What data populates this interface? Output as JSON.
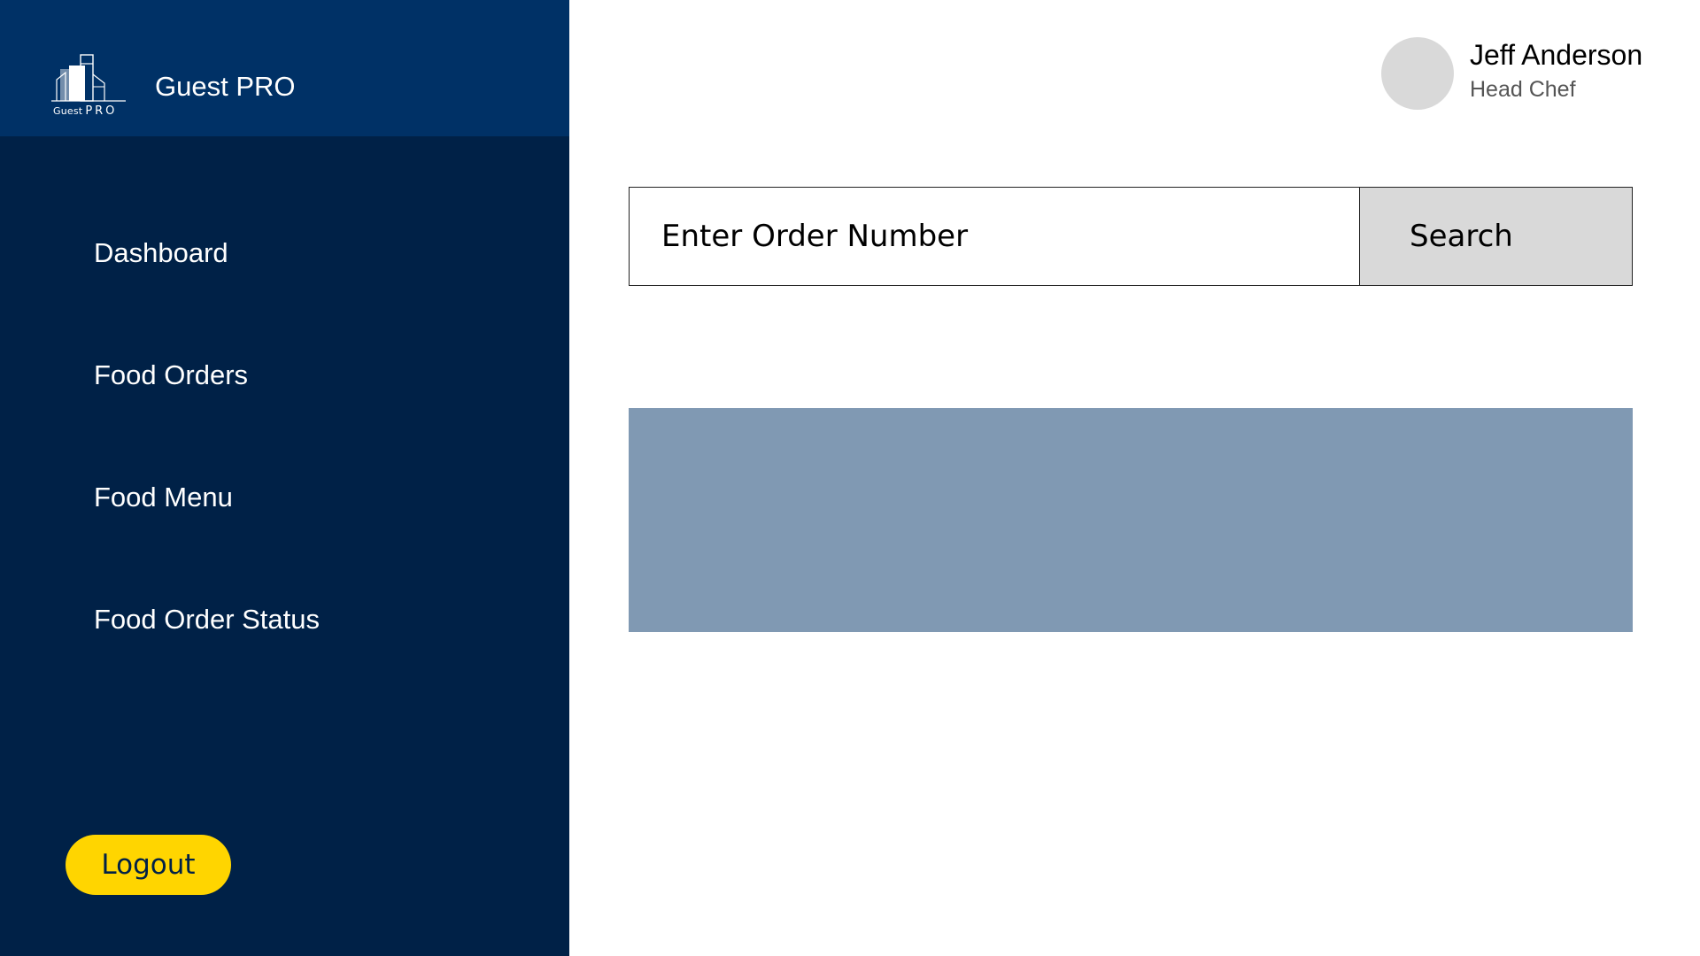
{
  "brand": {
    "logo_text": "Guest",
    "logo_text_pro": "PRO",
    "title": "Guest PRO"
  },
  "sidebar": {
    "items": [
      {
        "label": "Dashboard"
      },
      {
        "label": "Food Orders"
      },
      {
        "label": "Food Menu"
      },
      {
        "label": "Food Order Status"
      }
    ],
    "logout_label": "Logout"
  },
  "user": {
    "name": "Jeff Anderson",
    "role": "Head Chef"
  },
  "search": {
    "placeholder": "Enter Order Number",
    "value": "",
    "button_label": "Search"
  },
  "colors": {
    "sidebar_bg": "#002147",
    "brand_bar_bg": "#003166",
    "logout_bg": "#ffd500",
    "result_panel_bg": "#8099b3",
    "search_button_bg": "#d9d9d9"
  },
  "icons": {
    "logo": "building-logo-icon",
    "avatar": "user-avatar"
  }
}
